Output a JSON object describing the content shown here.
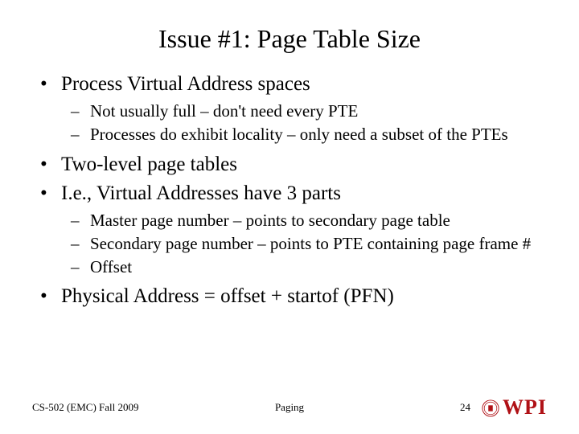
{
  "title": "Issue #1: Page Table Size",
  "bullets": {
    "b1": "Process Virtual Address spaces",
    "b1_sub": {
      "s1": "Not usually full – don't need every PTE",
      "s2": "Processes do exhibit locality – only need a subset of the PTEs"
    },
    "b2": "Two-level page tables",
    "b3": "I.e., Virtual Addresses have 3 parts",
    "b3_sub": {
      "s1": "Master page number – points to secondary page table",
      "s2": "Secondary page number – points to PTE containing page frame #",
      "s3": "Offset"
    },
    "b4": "Physical Address = offset + startof (PFN)"
  },
  "footer": {
    "left": "CS-502 (EMC) Fall 2009",
    "center": "Paging",
    "page": "24",
    "logo_text": "WPI"
  }
}
